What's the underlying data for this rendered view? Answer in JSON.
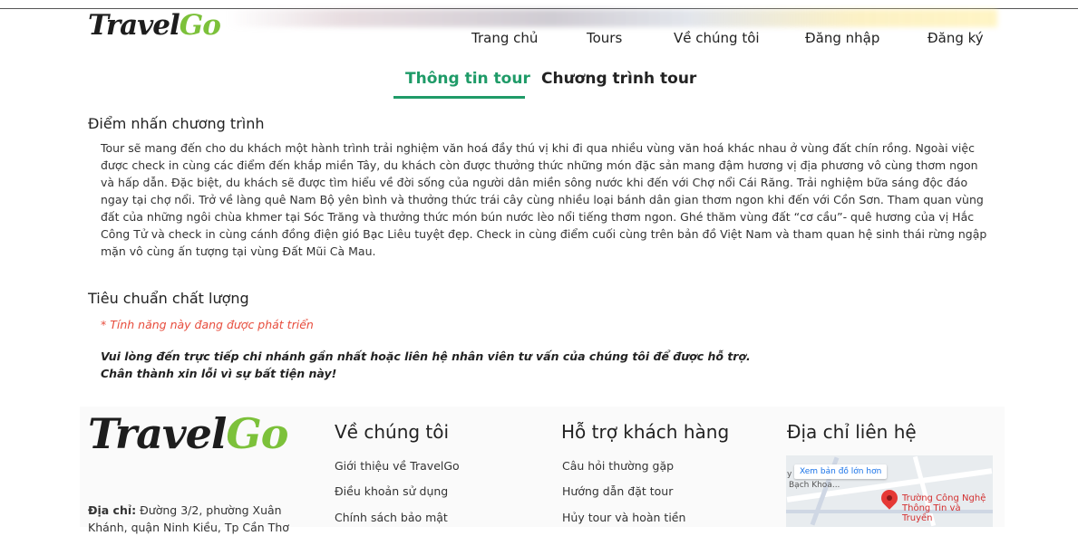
{
  "header": {
    "logo": {
      "part1": "Travel",
      "part2": "Go"
    },
    "nav": [
      "Trang chủ",
      "Tours",
      "Về chúng tôi",
      "Đăng nhập",
      "Đăng ký"
    ]
  },
  "tabs": [
    {
      "label": "Thông tin tour",
      "active": true
    },
    {
      "label": "Chương trình tour",
      "active": false
    }
  ],
  "highlights": {
    "title": "Điểm nhấn chương trình",
    "text": "Tour sẽ mang đến cho du khách một hành trình trải nghiệm văn hoá đầy thú vị khi đi qua nhiều vùng văn hoá khác nhau ở vùng đất chín rồng. Ngoài việc được check in cùng các điểm đến khắp miền Tây, du khách còn được thưởng thức những món đặc sản mang đậm hương vị địa phương vô cùng thơm ngon và hấp dẫn. Đặc biệt, du khách sẽ được tìm hiểu về đời sống của người dân miền sông nước khi đến với Chợ nổi Cái Răng. Trải nghiệm bữa sáng độc đáo ngay tại chợ nổi. Trở về làng quê Nam Bộ yên bình và thưởng thức trái cây cùng nhiều loại bánh dân gian thơm ngon khi đến với Cồn Sơn. Tham quan vùng đất của những ngôi chùa khmer tại Sóc Trăng và thưởng thức món bún nước lèo nổi tiếng thơm ngon. Ghé thăm vùng đất “cơ cầu”- quê hương của vị Hắc Công Tử và check in cùng cánh đồng điện gió Bạc Liêu tuyệt đẹp. Check in cùng điểm cuối cùng trên bản đồ Việt Nam và tham quan hệ sinh thái rừng ngập mặn vô cùng ấn tượng tại vùng Đất Mũi Cà Mau."
  },
  "quality": {
    "title": "Tiêu chuẩn chất lượng",
    "dev_note": "* Tính năng này đang được phát triển",
    "notice_line1": "Vui lòng đến trực tiếp chi nhánh gần nhất hoặc liên hệ nhân viên tư vấn của chúng tôi để được hỗ trợ.",
    "notice_line2": "Chân thành xin lỗi vì sự bất tiện này!"
  },
  "footer": {
    "logo": {
      "part1": "Travel",
      "part2": "Go"
    },
    "address_label": "Địa chỉ:",
    "address_text": "Đường 3/2, phường Xuân Khánh, quận Ninh Kiều, Tp Cần Thơ",
    "about": {
      "title": "Về chúng tôi",
      "links": [
        "Giới thiệu về TravelGo",
        "Điều khoản sử dụng",
        "Chính sách bảo mật"
      ]
    },
    "support": {
      "title": "Hỗ trợ khách hàng",
      "links": [
        "Câu hỏi thường gặp",
        "Hướng dẫn đặt tour",
        "Hủy tour và hoàn tiền"
      ]
    },
    "contact": {
      "title": "Địa chỉ liên hệ",
      "map_button": "Xem bản đồ lớn hơn",
      "map_place": "Trường Công Nghệ Thông Tin và Truyền",
      "map_street": "Bạch Khoa...",
      "map_y": "y"
    }
  },
  "colors": {
    "accent": "#1f9b68",
    "logo_green": "#7cc13a",
    "warning": "#e74c3c"
  }
}
